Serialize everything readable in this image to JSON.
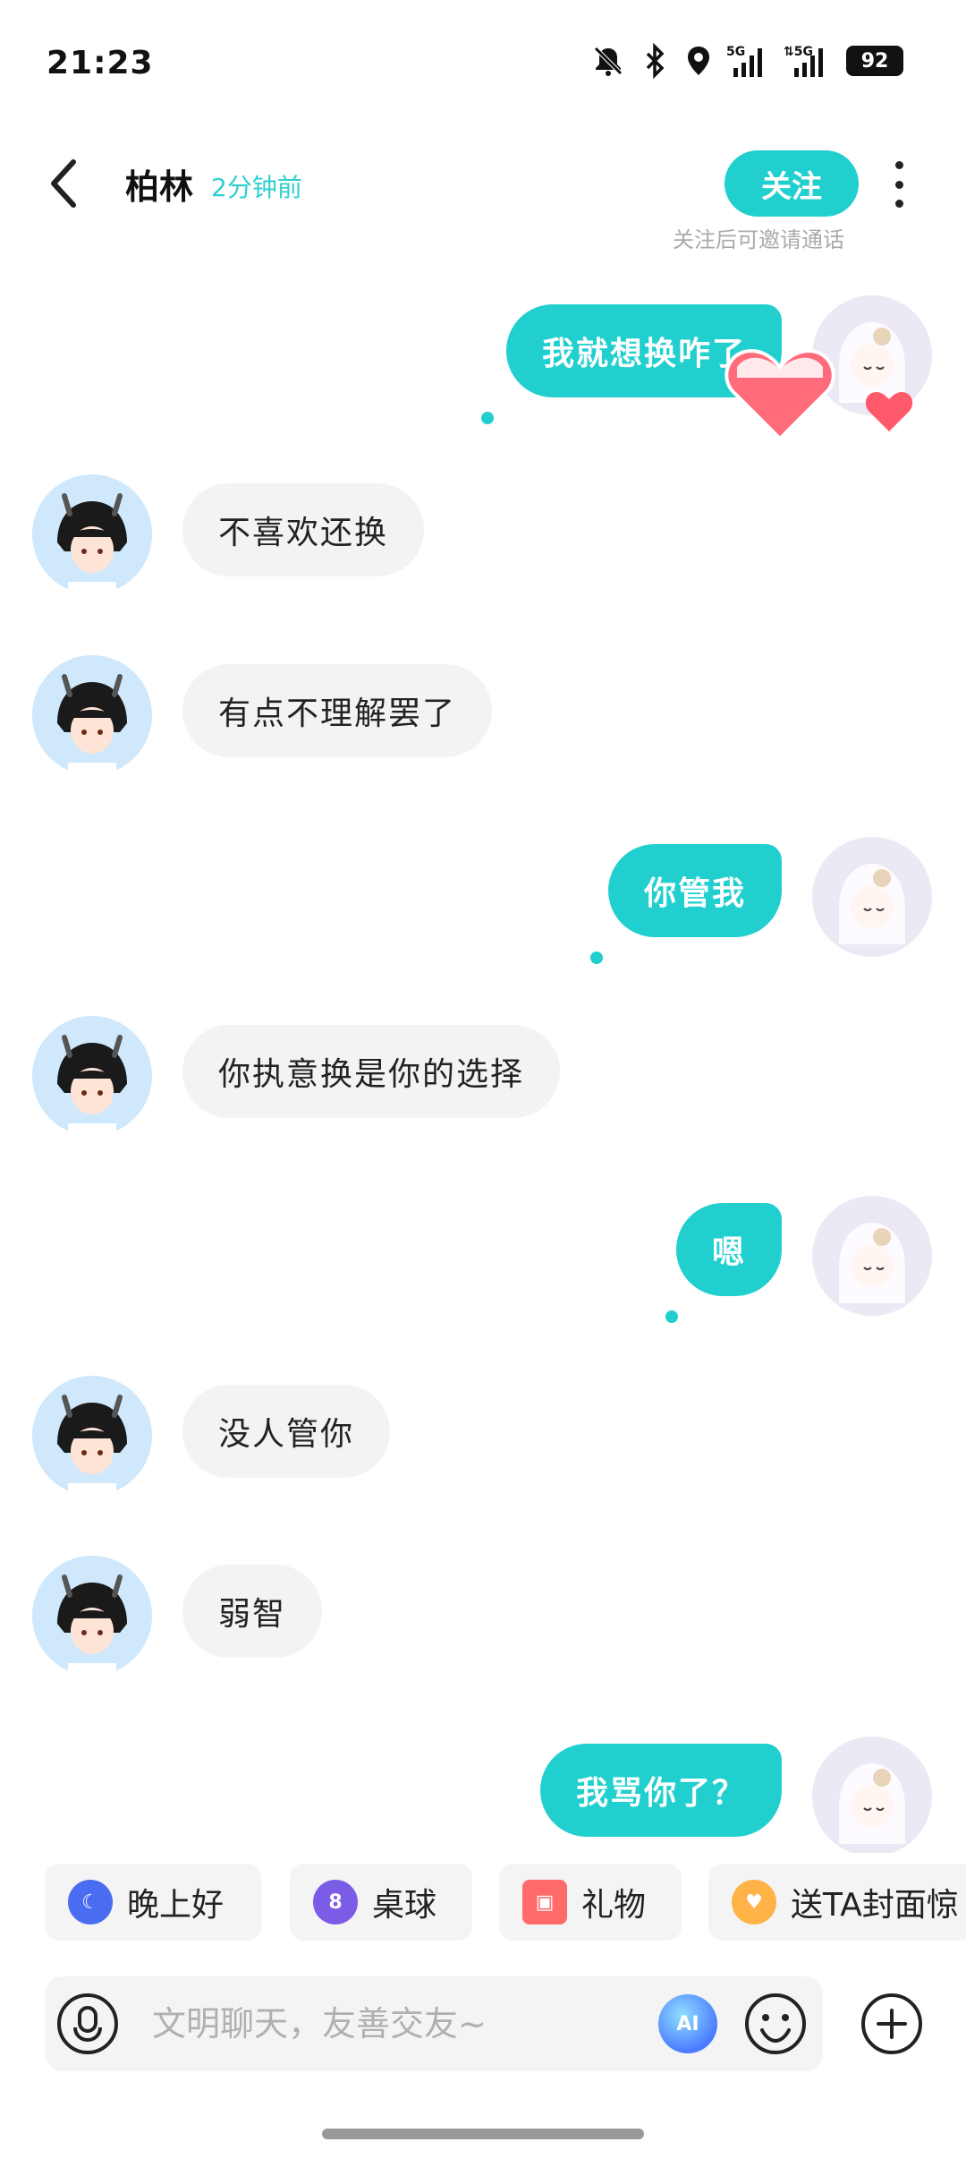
{
  "status_bar": {
    "time": "21:23",
    "battery": "92",
    "icons": [
      "bell-muted-icon",
      "bluetooth-icon",
      "location-icon",
      "signal-5g-icon",
      "signal-5g-icon"
    ]
  },
  "header": {
    "name": "柏林",
    "last_seen": "2分钟前",
    "follow_label": "关注",
    "follow_hint": "关注后可邀请通话"
  },
  "messages": [
    {
      "side": "out",
      "text": "我就想换咋了"
    },
    {
      "side": "in",
      "text": "不喜欢还换"
    },
    {
      "side": "in",
      "text": "有点不理解罢了"
    },
    {
      "side": "out",
      "text": "你管我"
    },
    {
      "side": "in",
      "text": "你执意换是你的选择"
    },
    {
      "side": "out",
      "text": "嗯"
    },
    {
      "side": "in",
      "text": "没人管你"
    },
    {
      "side": "in",
      "text": "弱智"
    },
    {
      "side": "out",
      "text": "我骂你了？"
    }
  ],
  "quick_chips": [
    {
      "label": "晚上好",
      "icon": "moon-icon"
    },
    {
      "label": "桌球",
      "icon": "billiard-ball-icon"
    },
    {
      "label": "礼物",
      "icon": "gift-icon"
    },
    {
      "label": "送TA封面惊",
      "icon": "heart-chat-icon"
    }
  ],
  "input": {
    "placeholder": "文明聊天，友善交友~"
  },
  "colors": {
    "accent": "#22cfcf",
    "incoming_bubble": "#f3f3f3",
    "hint": "#aaaaaa"
  }
}
